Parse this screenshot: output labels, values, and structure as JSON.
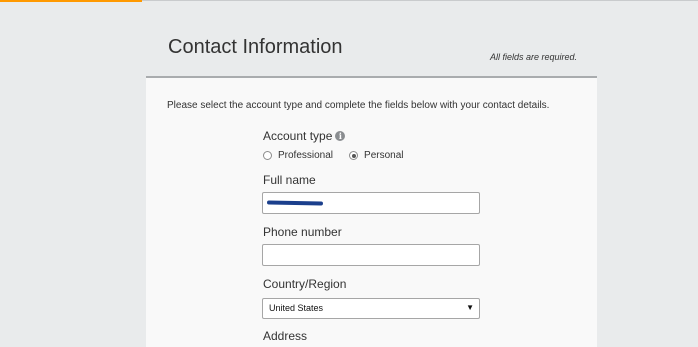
{
  "header": {
    "title": "Contact Information",
    "required_note": "All fields are required."
  },
  "form": {
    "instructions": "Please select the account type and complete the fields below with your contact details.",
    "account_type": {
      "label": "Account type",
      "info_icon": "info-icon",
      "options": [
        "Professional",
        "Personal"
      ],
      "selected": "Personal"
    },
    "full_name": {
      "label": "Full name",
      "value": "",
      "redacted": true
    },
    "phone_number": {
      "label": "Phone number",
      "value": ""
    },
    "country_region": {
      "label": "Country/Region",
      "selected": "United States",
      "arrow": "▼"
    },
    "address": {
      "label": "Address"
    }
  },
  "colors": {
    "accent": "#ff9900",
    "page_background": "#e9ebec",
    "panel_background": "#f9f9f9",
    "redaction": "#1b3f8c"
  }
}
